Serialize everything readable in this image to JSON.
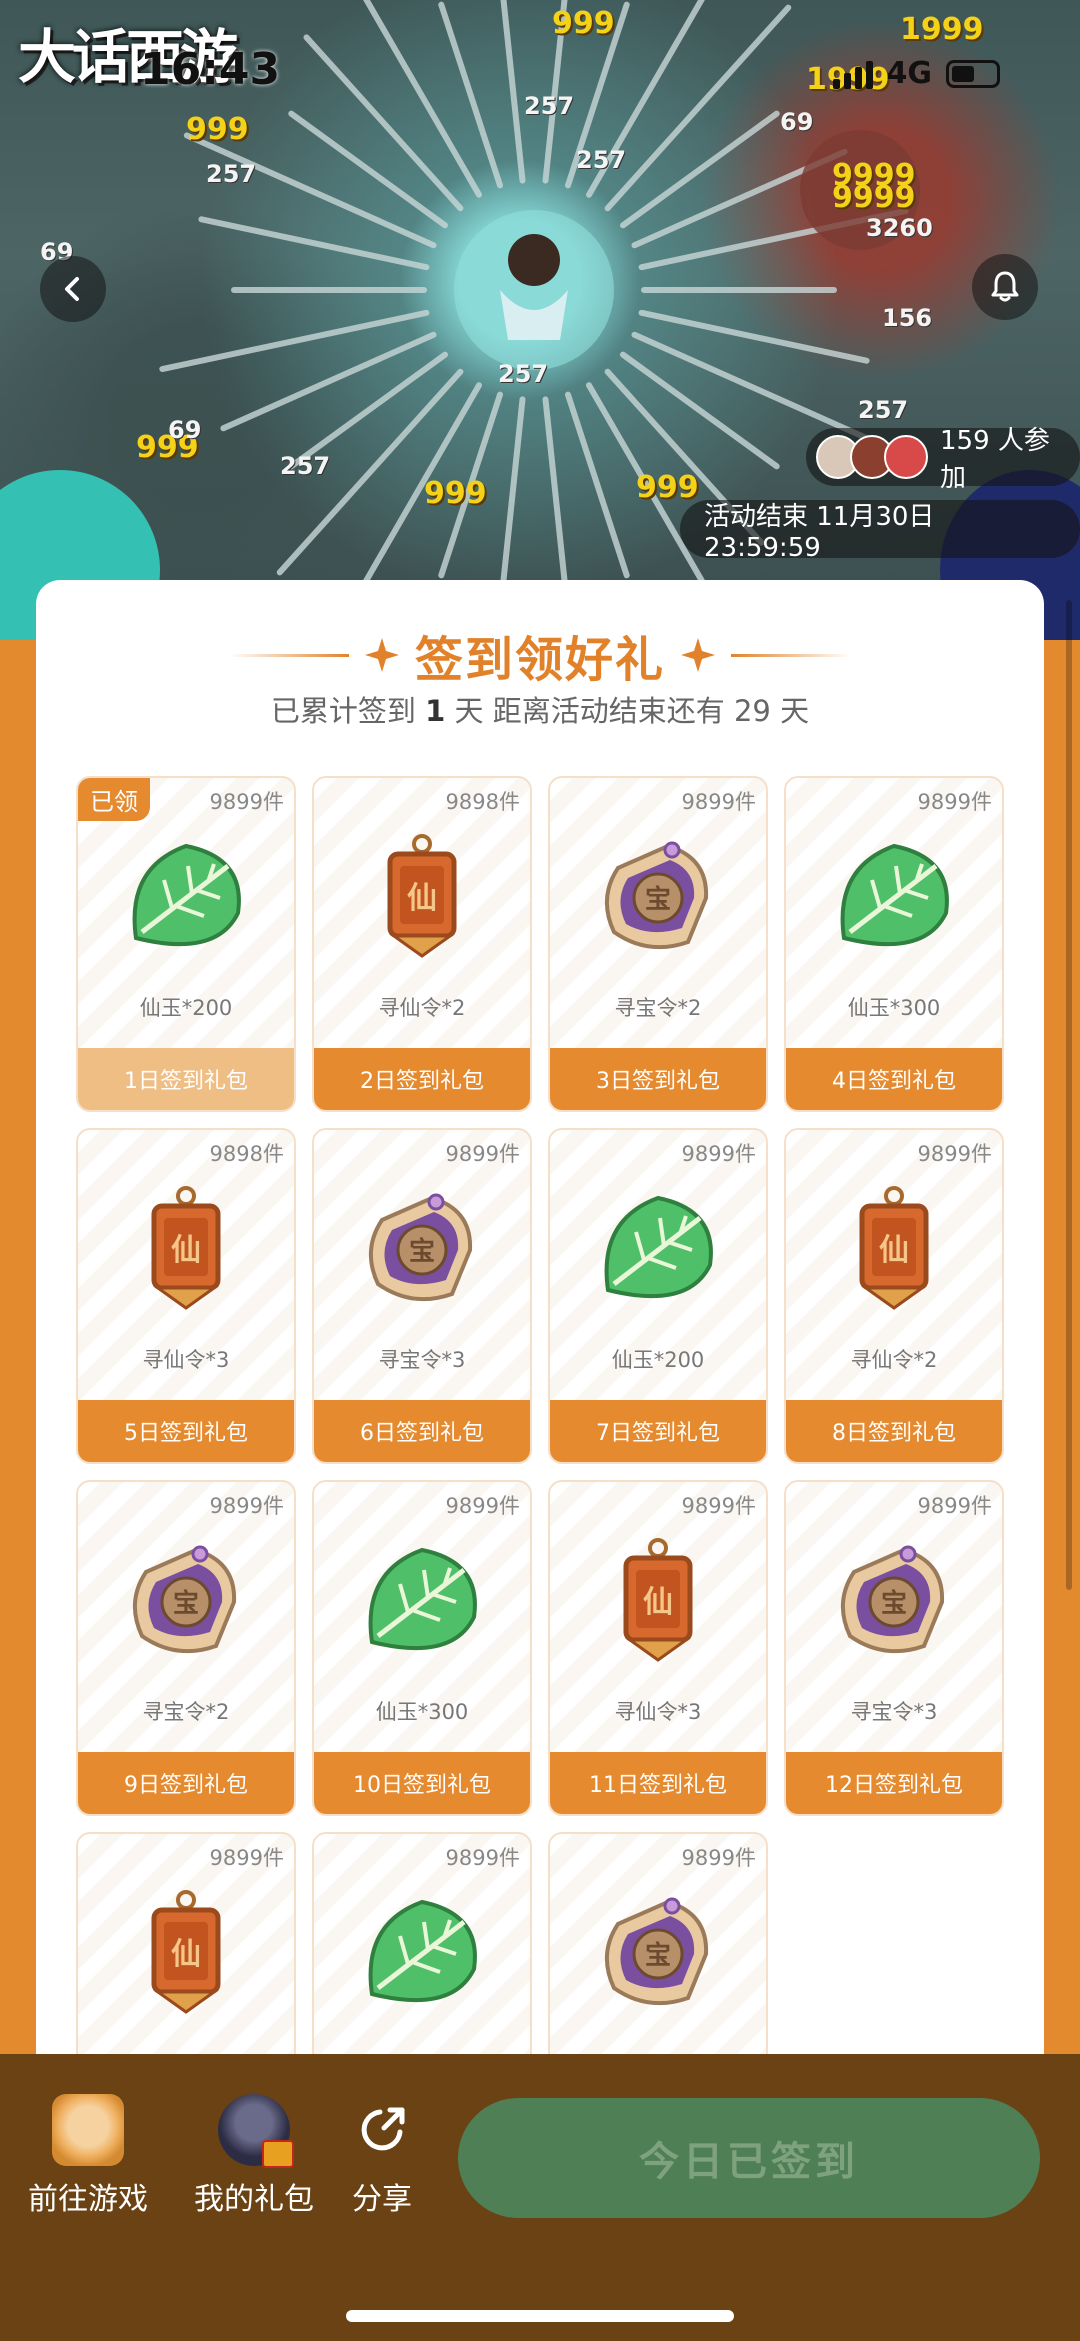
{
  "status_bar": {
    "time": "16:43",
    "network": "4G"
  },
  "hero": {
    "logo_text": "大话西游",
    "damage_numbers": [
      "999",
      "257",
      "999",
      "257",
      "257",
      "69",
      "9999",
      "9999",
      "3260",
      "156",
      "257",
      "999",
      "69",
      "257",
      "999",
      "999",
      "257",
      "1999",
      "1999",
      "69"
    ],
    "participants_text": "159 人参加",
    "end_time_text": "活动结束 11月30日 23:59:59"
  },
  "checkin": {
    "title": "签到领好礼",
    "summary_prefix": "已累计签到 ",
    "signed_days": "1",
    "summary_mid": " 天  距离活动结束还有 29 天",
    "claimed_label": "已领",
    "items": [
      {
        "stock": "9899件",
        "icon": "jade-leaf-icon",
        "name": "仙玉*200",
        "button": "1日签到礼包",
        "claimed": true
      },
      {
        "stock": "9898件",
        "icon": "xian-token-icon",
        "name": "寻仙令*2",
        "button": "2日签到礼包",
        "claimed": false
      },
      {
        "stock": "9899件",
        "icon": "treasure-token-icon",
        "name": "寻宝令*2",
        "button": "3日签到礼包",
        "claimed": false
      },
      {
        "stock": "9899件",
        "icon": "jade-leaf-icon",
        "name": "仙玉*300",
        "button": "4日签到礼包",
        "claimed": false
      },
      {
        "stock": "9898件",
        "icon": "xian-token-icon",
        "name": "寻仙令*3",
        "button": "5日签到礼包",
        "claimed": false
      },
      {
        "stock": "9899件",
        "icon": "treasure-token-icon",
        "name": "寻宝令*3",
        "button": "6日签到礼包",
        "claimed": false
      },
      {
        "stock": "9899件",
        "icon": "jade-leaf-icon",
        "name": "仙玉*200",
        "button": "7日签到礼包",
        "claimed": false
      },
      {
        "stock": "9899件",
        "icon": "xian-token-icon",
        "name": "寻仙令*2",
        "button": "8日签到礼包",
        "claimed": false
      },
      {
        "stock": "9899件",
        "icon": "treasure-token-icon",
        "name": "寻宝令*2",
        "button": "9日签到礼包",
        "claimed": false
      },
      {
        "stock": "9899件",
        "icon": "jade-leaf-icon",
        "name": "仙玉*300",
        "button": "10日签到礼包",
        "claimed": false
      },
      {
        "stock": "9899件",
        "icon": "xian-token-icon",
        "name": "寻仙令*3",
        "button": "11日签到礼包",
        "claimed": false
      },
      {
        "stock": "9899件",
        "icon": "treasure-token-icon",
        "name": "寻宝令*3",
        "button": "12日签到礼包",
        "claimed": false
      },
      {
        "stock": "9899件",
        "icon": "xian-token-icon",
        "name": "",
        "button": "",
        "claimed": false
      },
      {
        "stock": "9899件",
        "icon": "jade-leaf-icon",
        "name": "",
        "button": "",
        "claimed": false
      },
      {
        "stock": "9899件",
        "icon": "treasure-token-icon",
        "name": "",
        "button": "",
        "claimed": false
      }
    ]
  },
  "bottom_bar": {
    "go_game": "前往游戏",
    "my_gifts": "我的礼包",
    "share": "分享",
    "signed_button": "今日已签到"
  },
  "colors": {
    "accent_orange": "#e58a2e",
    "claimed_orange": "#efbe85",
    "bottom_brown": "#6b4214",
    "signed_green": "#4f7f55"
  }
}
